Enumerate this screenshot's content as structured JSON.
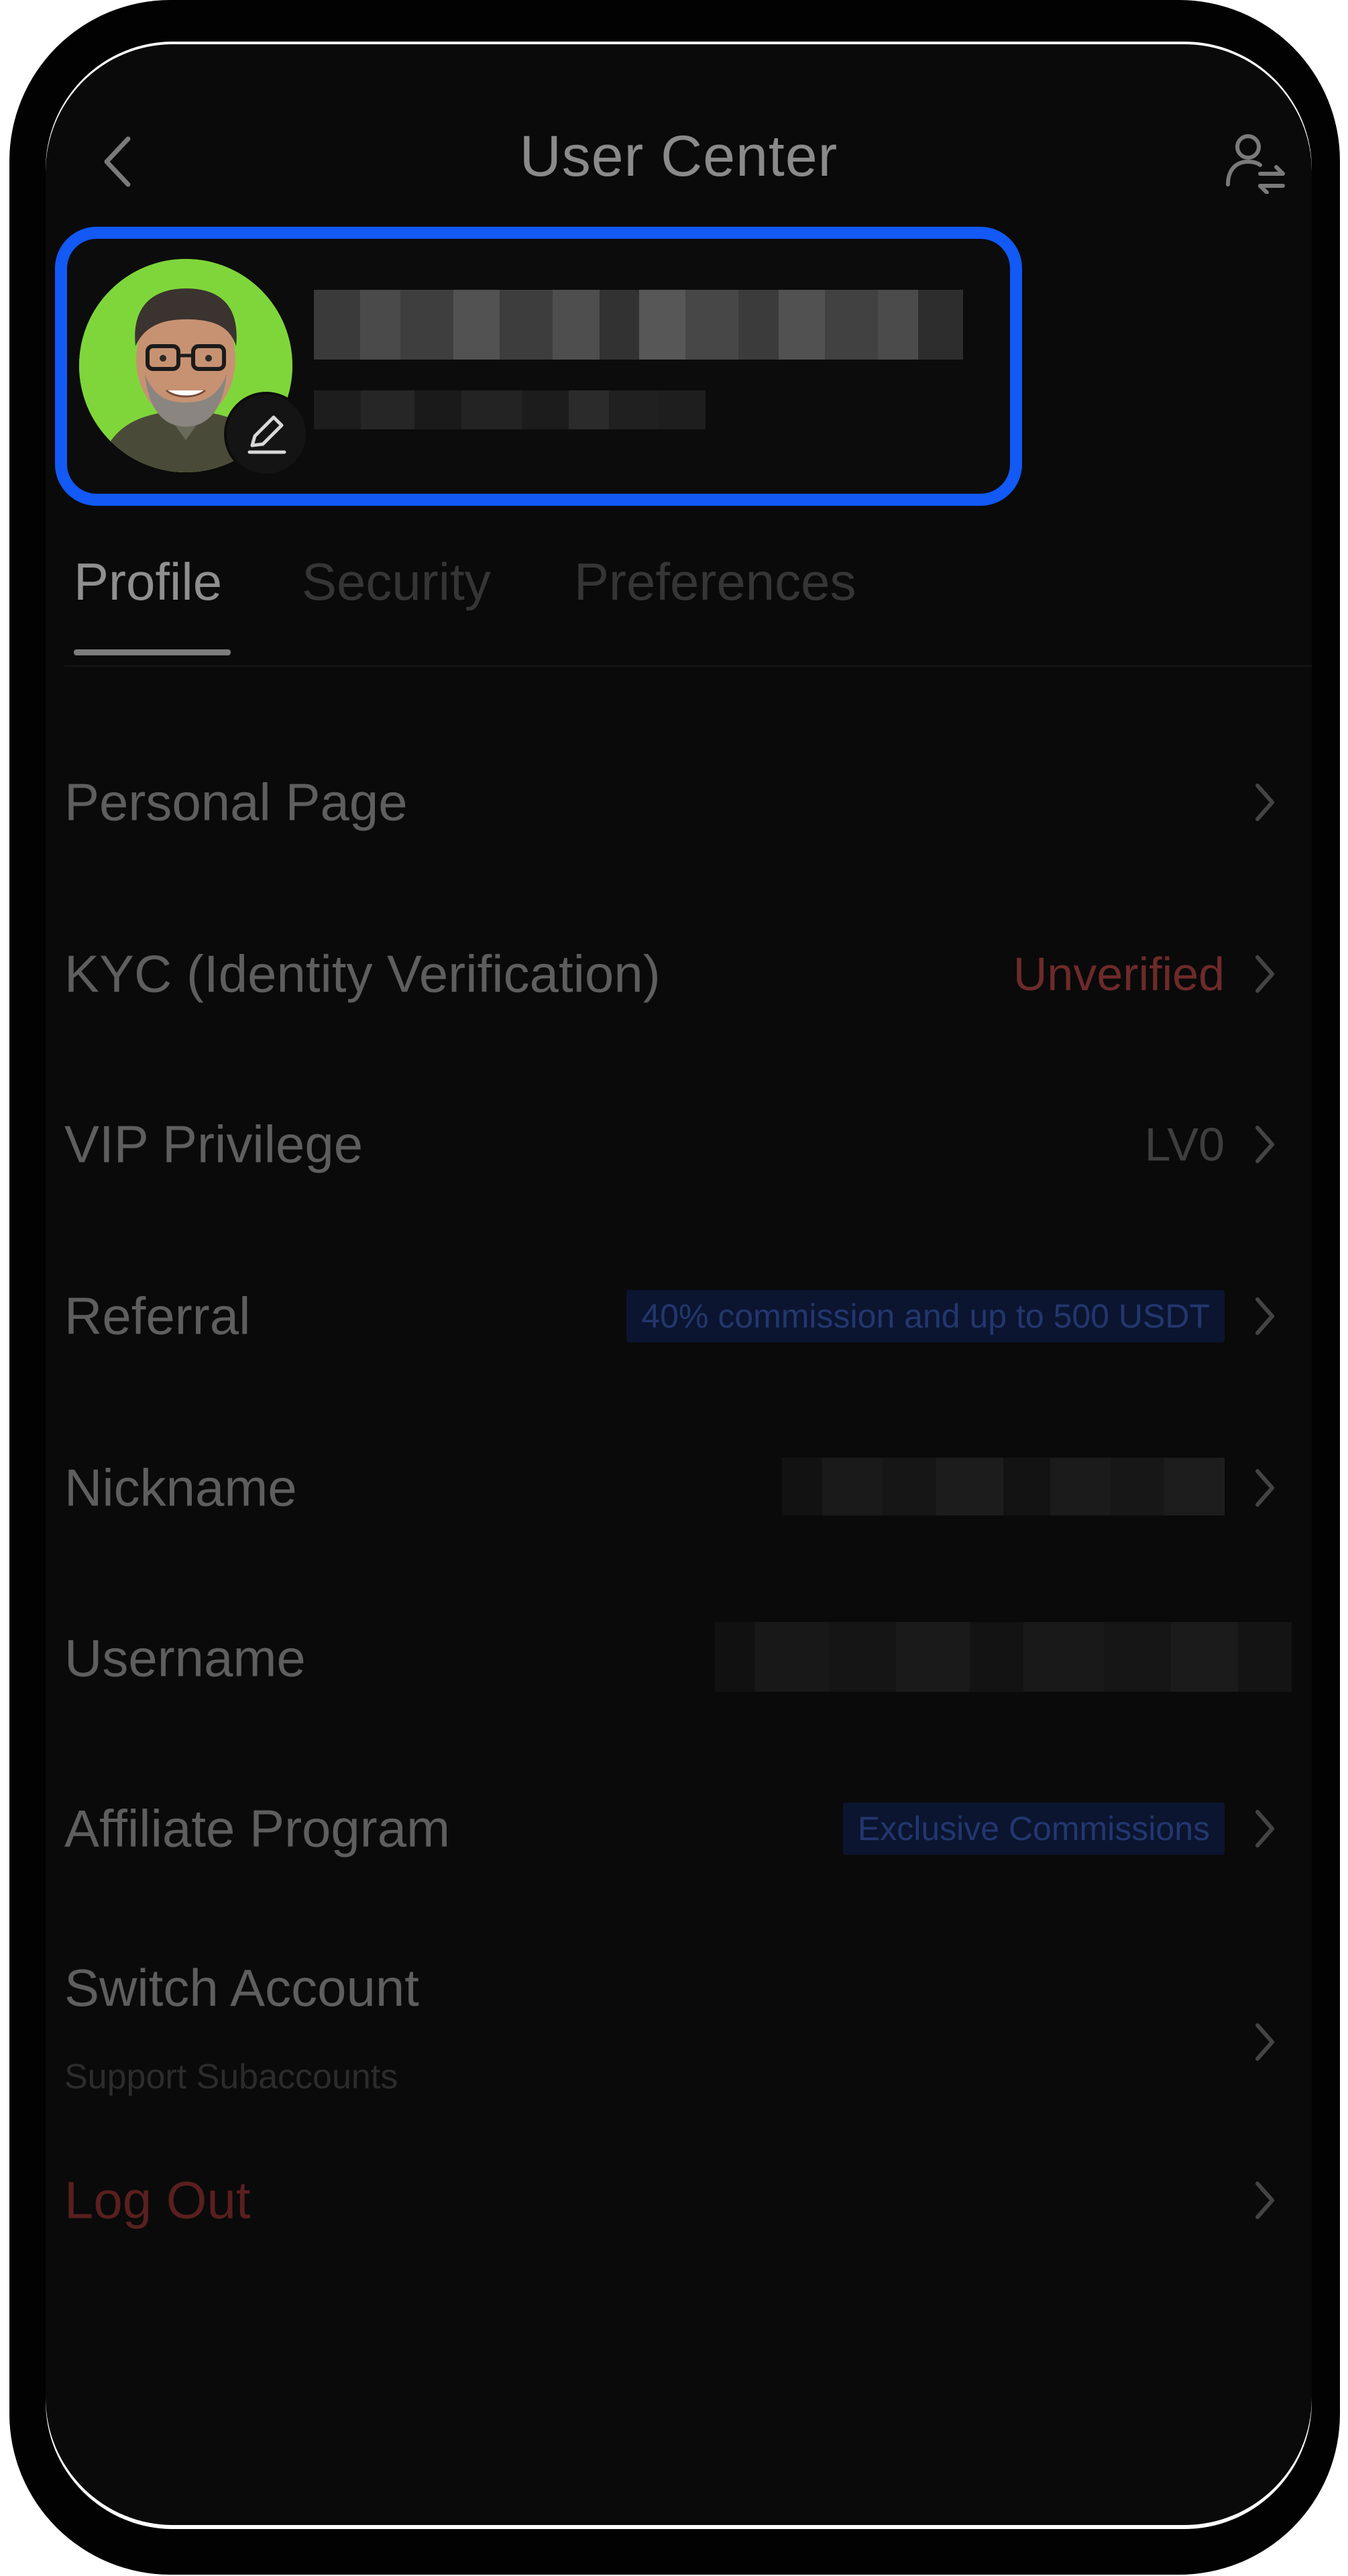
{
  "header": {
    "title": "User Center",
    "back_icon": "chevron-left-icon",
    "switch_icon": "user-switch-icon"
  },
  "profile": {
    "avatar_icon": "user-avatar",
    "edit_icon": "pencil-icon",
    "avatar_bg": "#7fd63a",
    "highlight_color": "#1259f5"
  },
  "tabs": [
    {
      "label": "Profile",
      "active": true
    },
    {
      "label": "Security",
      "active": false
    },
    {
      "label": "Preferences",
      "active": false
    }
  ],
  "rows": {
    "personal_page": {
      "label": "Personal Page"
    },
    "kyc": {
      "label": "KYC (Identity Verification)",
      "value": "Unverified",
      "value_color": "#6e2a2a"
    },
    "vip": {
      "label": "VIP Privilege",
      "value": "LV0"
    },
    "referral": {
      "label": "Referral",
      "badge": "40% commission and up to 500 USDT"
    },
    "nickname": {
      "label": "Nickname"
    },
    "username": {
      "label": "Username"
    },
    "affiliate": {
      "label": "Affiliate Program",
      "badge": "Exclusive Commissions"
    },
    "switch_account": {
      "label": "Switch Account",
      "sublabel": "Support Subaccounts"
    },
    "logout": {
      "label": "Log Out",
      "color": "#5a1f1f"
    }
  }
}
